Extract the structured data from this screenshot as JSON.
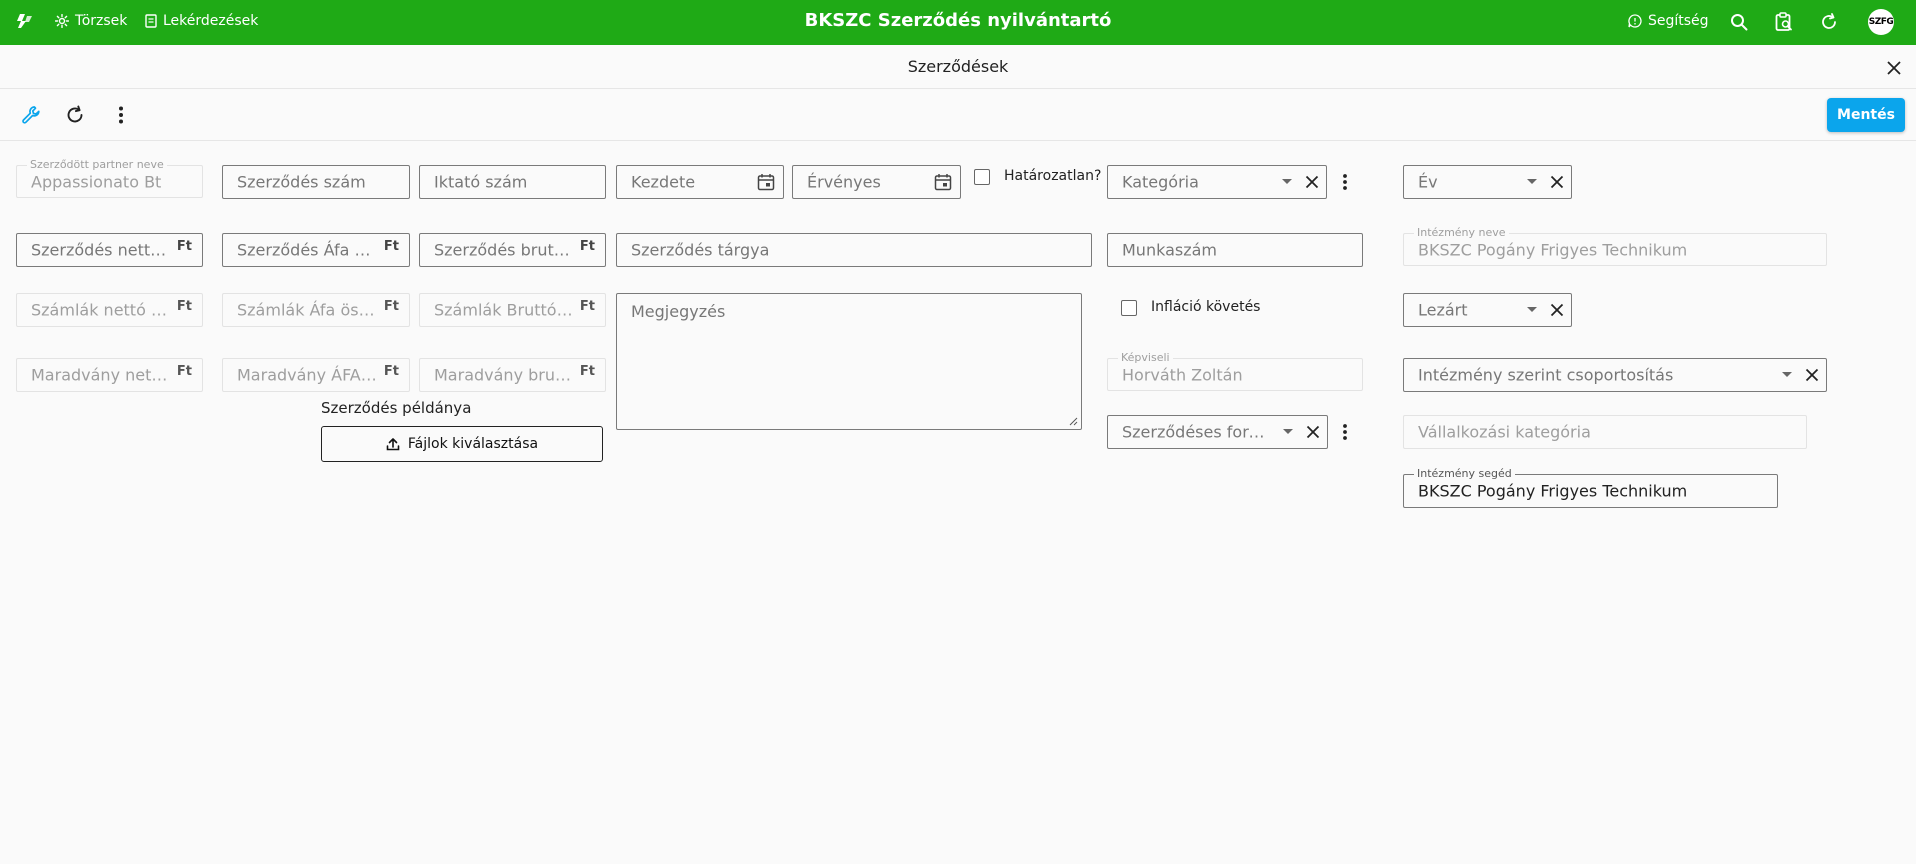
{
  "app": {
    "title": "BKSZC Szerződés nyilvántartó"
  },
  "nav": {
    "torzsek": "Törzsek",
    "lekerdezesek": "Lekérdezések",
    "help": "Segítség",
    "avatar": "SZFG"
  },
  "page": {
    "title": "Szerződések"
  },
  "toolbar": {
    "save_label": "Mentés"
  },
  "form": {
    "partner": {
      "label": "Szerződött partner neve",
      "value": "Appassionato Bt"
    },
    "szerzodes_szam": {
      "placeholder": "Szerződés szám"
    },
    "iktato_szam": {
      "placeholder": "Iktató szám"
    },
    "kezdete": {
      "placeholder": "Kezdete"
    },
    "ervenyes": {
      "placeholder": "Érvényes"
    },
    "hatarozatlan": {
      "label": "Határozatlan?",
      "checked": false
    },
    "kategoria": {
      "placeholder": "Kategória"
    },
    "ev": {
      "placeholder": "Év"
    },
    "netto": {
      "placeholder": "Szerződés nettó összeg",
      "unit": "Ft"
    },
    "afa": {
      "placeholder": "Szerződés Áfa összeg",
      "unit": "Ft"
    },
    "brutto": {
      "placeholder": "Szerződés bruttó összeg",
      "unit": "Ft"
    },
    "targy": {
      "placeholder": "Szerződés tárgya"
    },
    "munkaszam": {
      "placeholder": "Munkaszám"
    },
    "intezmeny_neve": {
      "label": "Intézmény neve",
      "value": "BKSZC Pogány Frigyes Technikum"
    },
    "szamlak_netto": {
      "placeholder": "Számlák nettó összeg",
      "unit": "Ft"
    },
    "szamlak_afa": {
      "placeholder": "Számlák Áfa összeg",
      "unit": "Ft"
    },
    "szamlak_brutto": {
      "placeholder": "Számlák Bruttó összeg",
      "unit": "Ft"
    },
    "megjegyzes": {
      "placeholder": "Megjegyzés"
    },
    "inflacio": {
      "label": "Infláció követés",
      "checked": false
    },
    "lezart": {
      "placeholder": "Lezárt"
    },
    "maradvany_netto": {
      "placeholder": "Maradvány nettó összeg",
      "unit": "Ft"
    },
    "maradvany_afa": {
      "placeholder": "Maradvány ÁFA összeg",
      "unit": "Ft"
    },
    "maradvany_brutto": {
      "placeholder": "Maradvány bruttó összeg",
      "unit": "Ft"
    },
    "kepviseli": {
      "label": "Képviseli",
      "value": "Horváth Zoltán"
    },
    "csoportositas": {
      "placeholder": "Intézmény szerint csoportosítás"
    },
    "peldany": {
      "label": "Szerződés példánya",
      "button": "Fájlok kiválasztása"
    },
    "forma": {
      "placeholder": "Szerződéses forma"
    },
    "vallalkozasi": {
      "placeholder": "Vállalkozási kategória"
    },
    "intezmeny_seged": {
      "label": "Intézmény segéd",
      "value": "BKSZC Pogány Frigyes Technikum"
    }
  }
}
